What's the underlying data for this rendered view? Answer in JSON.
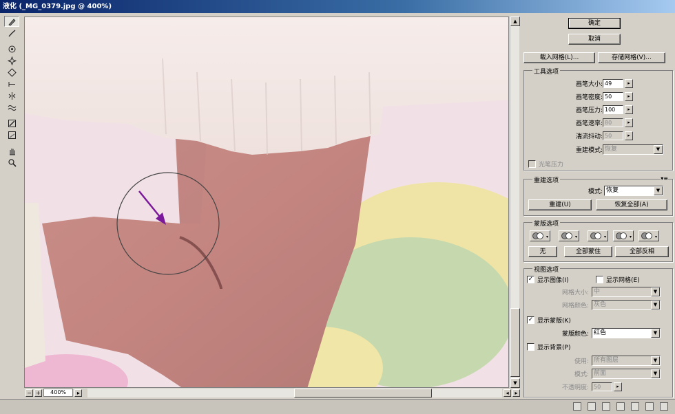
{
  "window": {
    "title": "液化 (_MG_0379.jpg @ 400%)"
  },
  "tools": [
    {
      "name": "forward-warp-tool",
      "active": true
    },
    {
      "name": "reconstruct-tool"
    },
    {
      "name": "twirl-clockwise-tool"
    },
    {
      "name": "pucker-tool"
    },
    {
      "name": "bloat-tool"
    },
    {
      "name": "push-left-tool"
    },
    {
      "name": "mirror-tool"
    },
    {
      "name": "turbulence-tool"
    },
    {
      "name": "freeze-mask-tool"
    },
    {
      "name": "thaw-mask-tool"
    },
    {
      "name": "hand-tool"
    },
    {
      "name": "zoom-tool"
    }
  ],
  "status": {
    "zoom": "400%"
  },
  "panel": {
    "ok": "确定",
    "cancel": "取消",
    "load_mesh": "载入网格(L)...",
    "save_mesh": "存储网格(V)...",
    "tool_options": {
      "title": "工具选项",
      "brush_size_label": "画笔大小:",
      "brush_size": "49",
      "brush_density_label": "画笔密度:",
      "brush_density": "50",
      "brush_pressure_label": "画笔压力:",
      "brush_pressure": "100",
      "brush_rate_label": "画笔速率:",
      "brush_rate": "80",
      "turbulent_jitter_label": "湍流抖动:",
      "turbulent_jitter": "50",
      "reconstruct_mode_label": "重建模式:",
      "reconstruct_mode": "恢复",
      "stylus_pressure": "光笔压力"
    },
    "reconstruct_options": {
      "title": "重建选项",
      "mode_label": "模式:",
      "mode": "恢复",
      "reconstruct_btn": "重建(U)",
      "restore_all_btn": "恢复全部(A)"
    },
    "mask_options": {
      "title": "蒙版选项",
      "none_btn": "无",
      "mask_all_btn": "全部蒙住",
      "invert_all_btn": "全部反相"
    },
    "view_options": {
      "title": "视图选项",
      "show_image": "显示图像(I)",
      "show_mesh": "显示网格(E)",
      "mesh_size_label": "网格大小:",
      "mesh_size": "中",
      "mesh_color_label": "网格颜色:",
      "mesh_color": "灰色",
      "show_mask": "显示蒙版(K)",
      "mask_color_label": "蒙版颜色:",
      "mask_color": "红色",
      "show_backdrop": "显示背景(P)",
      "use_label": "使用:",
      "use": "所有图层",
      "mode_label": "模式:",
      "mode": "前面",
      "opacity_label": "不透明度:",
      "opacity": "50"
    }
  }
}
